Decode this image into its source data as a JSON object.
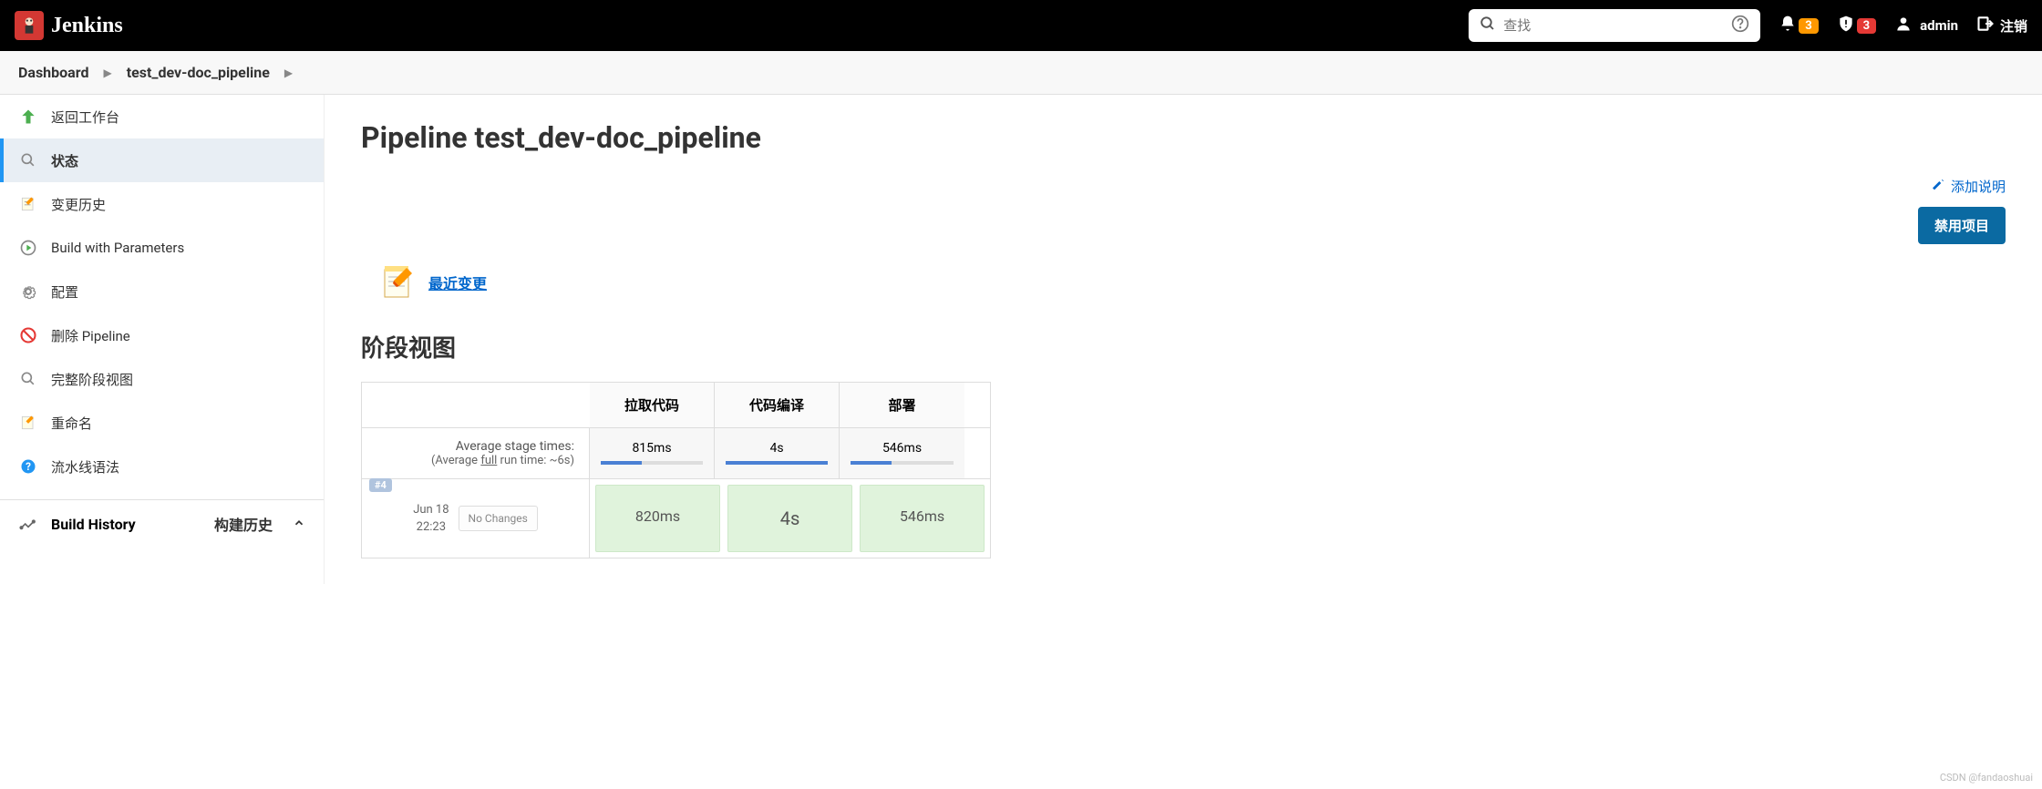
{
  "header": {
    "logo_text": "Jenkins",
    "search_placeholder": "查找",
    "notif_badge": "3",
    "alert_badge": "3",
    "username": "admin",
    "logout": "注销"
  },
  "breadcrumb": {
    "items": [
      "Dashboard",
      "test_dev-doc_pipeline"
    ]
  },
  "sidebar": {
    "items": [
      {
        "label": "返回工作台",
        "icon": "arrow-up"
      },
      {
        "label": "状态",
        "icon": "search",
        "active": true
      },
      {
        "label": "变更历史",
        "icon": "notepad"
      },
      {
        "label": "Build with Parameters",
        "icon": "play-clock"
      },
      {
        "label": "配置",
        "icon": "gear"
      },
      {
        "label": "删除 Pipeline",
        "icon": "no-entry"
      },
      {
        "label": "完整阶段视图",
        "icon": "search"
      },
      {
        "label": "重命名",
        "icon": "notepad"
      },
      {
        "label": "流水线语法",
        "icon": "question"
      }
    ],
    "history_title": "Build History",
    "history_label": "构建历史"
  },
  "main": {
    "title": "Pipeline test_dev-doc_pipeline",
    "add_description": "添加说明",
    "disable_project": "禁用项目",
    "recent_changes": "最近变更",
    "stage_view_title": "阶段视图",
    "stage_headers": [
      "拉取代码",
      "代码编译",
      "部署"
    ],
    "avg_label": "Average stage times:",
    "full_runtime_prefix": "(Average ",
    "full_runtime_underline": "full",
    "full_runtime_suffix": " run time: ~6s)",
    "avg_times": [
      "815ms",
      "4s",
      "546ms"
    ],
    "build": {
      "num": "#4",
      "date": "Jun 18",
      "time": "22:23",
      "no_changes": "No Changes",
      "times": [
        "820ms",
        "4s",
        "546ms"
      ]
    }
  },
  "watermark": "CSDN @fandaoshuai"
}
